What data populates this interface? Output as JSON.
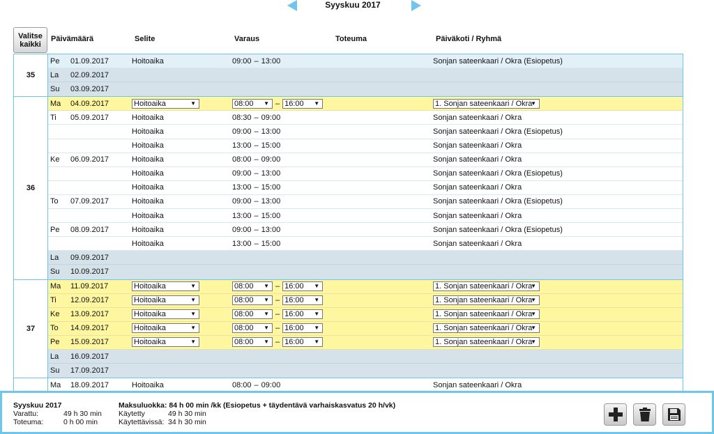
{
  "month_nav": {
    "title": "Syyskuu 2017"
  },
  "toolbar": {
    "select_all_line1": "Valitse",
    "select_all_line2": "kaikki"
  },
  "columns": {
    "date": "Päivämäärä",
    "selite": "Selite",
    "varaus": "Varaus",
    "toteuma": "Toteuma",
    "unit": "Päiväkoti / Ryhmä"
  },
  "weeks": [
    {
      "num": "35",
      "rows": [
        {
          "day": "Pe",
          "date": "01.09.2017",
          "type": "light",
          "selite": "Hoitoaika",
          "start": "09:00",
          "end": "13:00",
          "unit": "Sonjan sateenkaari / Okra (Esiopetus)"
        },
        {
          "day": "La",
          "date": "02.09.2017",
          "type": "wkend"
        },
        {
          "day": "Su",
          "date": "03.09.2017",
          "type": "wkend"
        }
      ]
    },
    {
      "num": "36",
      "rows": [
        {
          "day": "Ma",
          "date": "04.09.2017",
          "type": "edit",
          "selite": "Hoitoaika",
          "start": "08:00",
          "end": "16:00",
          "unit": "1. Sonjan sateenkaari / Okra"
        },
        {
          "day": "Ti",
          "date": "05.09.2017",
          "type": "normal",
          "selite": "Hoitoaika",
          "start": "08:30",
          "end": "09:00",
          "unit": "Sonjan sateenkaari / Okra"
        },
        {
          "day": "",
          "date": "",
          "type": "normal",
          "selite": "Hoitoaika",
          "start": "09:00",
          "end": "13:00",
          "unit": "Sonjan sateenkaari / Okra (Esiopetus)"
        },
        {
          "day": "",
          "date": "",
          "type": "normal",
          "selite": "Hoitoaika",
          "start": "13:00",
          "end": "15:00",
          "unit": "Sonjan sateenkaari / Okra"
        },
        {
          "day": "Ke",
          "date": "06.09.2017",
          "type": "normal",
          "selite": "Hoitoaika",
          "start": "08:00",
          "end": "09:00",
          "unit": "Sonjan sateenkaari / Okra"
        },
        {
          "day": "",
          "date": "",
          "type": "normal",
          "selite": "Hoitoaika",
          "start": "09:00",
          "end": "13:00",
          "unit": "Sonjan sateenkaari / Okra (Esiopetus)"
        },
        {
          "day": "",
          "date": "",
          "type": "normal",
          "selite": "Hoitoaika",
          "start": "13:00",
          "end": "15:00",
          "unit": "Sonjan sateenkaari / Okra"
        },
        {
          "day": "To",
          "date": "07.09.2017",
          "type": "normal",
          "selite": "Hoitoaika",
          "start": "09:00",
          "end": "13:00",
          "unit": "Sonjan sateenkaari / Okra (Esiopetus)"
        },
        {
          "day": "",
          "date": "",
          "type": "normal",
          "selite": "Hoitoaika",
          "start": "13:00",
          "end": "15:00",
          "unit": "Sonjan sateenkaari / Okra"
        },
        {
          "day": "Pe",
          "date": "08.09.2017",
          "type": "normal",
          "selite": "Hoitoaika",
          "start": "09:00",
          "end": "13:00",
          "unit": "Sonjan sateenkaari / Okra (Esiopetus)"
        },
        {
          "day": "",
          "date": "",
          "type": "normal",
          "selite": "Hoitoaika",
          "start": "13:00",
          "end": "15:00",
          "unit": "Sonjan sateenkaari / Okra"
        },
        {
          "day": "La",
          "date": "09.09.2017",
          "type": "wkend"
        },
        {
          "day": "Su",
          "date": "10.09.2017",
          "type": "wkend"
        }
      ]
    },
    {
      "num": "37",
      "rows": [
        {
          "day": "Ma",
          "date": "11.09.2017",
          "type": "edit",
          "selite": "Hoitoaika",
          "start": "08:00",
          "end": "16:00",
          "unit": "1. Sonjan sateenkaari / Okra"
        },
        {
          "day": "Ti",
          "date": "12.09.2017",
          "type": "edit",
          "selite": "Hoitoaika",
          "start": "08:00",
          "end": "16:00",
          "unit": "1. Sonjan sateenkaari / Okra"
        },
        {
          "day": "Ke",
          "date": "13.09.2017",
          "type": "edit",
          "selite": "Hoitoaika",
          "start": "08:00",
          "end": "16:00",
          "unit": "1. Sonjan sateenkaari / Okra"
        },
        {
          "day": "To",
          "date": "14.09.2017",
          "type": "edit",
          "selite": "Hoitoaika",
          "start": "08:00",
          "end": "16:00",
          "unit": "1. Sonjan sateenkaari / Okra"
        },
        {
          "day": "Pe",
          "date": "15.09.2017",
          "type": "edit",
          "selite": "Hoitoaika",
          "start": "08:00",
          "end": "16:00",
          "unit": "1. Sonjan sateenkaari / Okra"
        },
        {
          "day": "La",
          "date": "16.09.2017",
          "type": "wkend"
        },
        {
          "day": "Su",
          "date": "17.09.2017",
          "type": "wkend"
        }
      ]
    },
    {
      "num": "",
      "rows": [
        {
          "day": "Ma",
          "date": "18.09.2017",
          "type": "normal",
          "selite": "Hoitoaika",
          "start": "08:00",
          "end": "09:00",
          "unit": "Sonjan sateenkaari / Okra"
        }
      ]
    }
  ],
  "summary": {
    "month": "Syyskuu 2017",
    "reserved_label": "Varattu:",
    "reserved_value": "49 h 30 min",
    "actual_label": "Toteuma:",
    "actual_value": "0 h 00 min",
    "fee_class": "Maksuluokka: 84 h 00 min /kk (Esiopetus + täydentävä varhaiskasvatus 20 h/vk)",
    "used_label": "Käytetty",
    "used_value": "49 h 30 min",
    "available_label": "Käytettävissä:",
    "available_value": "34 h 30 min"
  },
  "icons": {
    "prev": "chevron-left-icon",
    "next": "chevron-right-icon",
    "add": "plus-icon",
    "delete": "trash-icon",
    "save": "floppy-disk-icon"
  },
  "colors": {
    "accent": "#6ec6ec",
    "edit_row": "#fff7a0",
    "weekend_row": "#d5e2ea"
  }
}
